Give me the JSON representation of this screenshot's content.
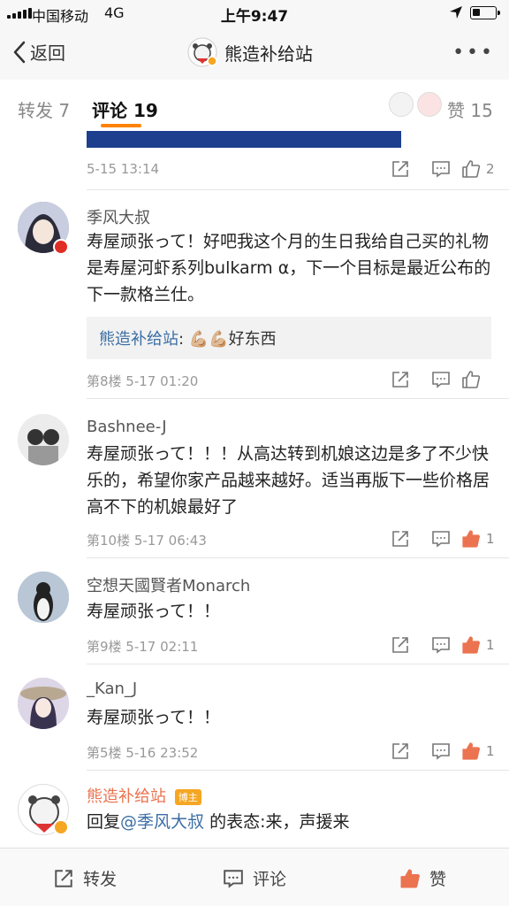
{
  "status_bar": {
    "carrier": "中国移动",
    "network": "4G",
    "time": "上午9:47"
  },
  "nav": {
    "back_label": "返回",
    "title": "熊造补给站"
  },
  "tabs": [
    {
      "label": "转发 7"
    },
    {
      "label": "评论 19"
    },
    {
      "label": "赞 15"
    }
  ],
  "previous": {
    "meta": "5-15 13:14",
    "like_count": "2"
  },
  "comments": [
    {
      "name": "季风大叔",
      "text": "寿屋顽张って！好吧我这个月的生日我给自己买的礼物是寿屋河虾系列bulkarm α，下一个目标是最近公布的下一款格兰仕。",
      "reply_name": "熊造补给站",
      "reply_text": "💪🏼💪🏼好东西",
      "meta": "第8楼 5-17 01:20",
      "like_count": ""
    },
    {
      "name": "Bashnee-J",
      "text": "寿屋顽张って！！！从高达转到机娘这边是多了不少快乐的，希望你家产品越来越好。适当再版下一些价格居高不下的机娘最好了",
      "meta": "第10楼 5-17 06:43",
      "like_count": "1"
    },
    {
      "name": "空想天國賢者Monarch",
      "text": "寿屋顽张って！！",
      "meta": "第9楼 5-17 02:11",
      "like_count": "1"
    },
    {
      "name": "_Kan_J",
      "text": "寿屋顽张って！！",
      "meta": "第5楼 5-16 23:52",
      "like_count": "1"
    },
    {
      "name": "熊造补给站",
      "badge": "博主",
      "reply_prefix": "回复",
      "mention": "@季风大叔",
      "reply_suffix": " 的表态:来，声援来"
    }
  ],
  "bottom_bar": {
    "repost": "转发",
    "comment": "评论",
    "like": "赞"
  },
  "colors": {
    "accent": "#ff8200",
    "link": "#3b6ea5",
    "like_active": "#eb7350"
  }
}
